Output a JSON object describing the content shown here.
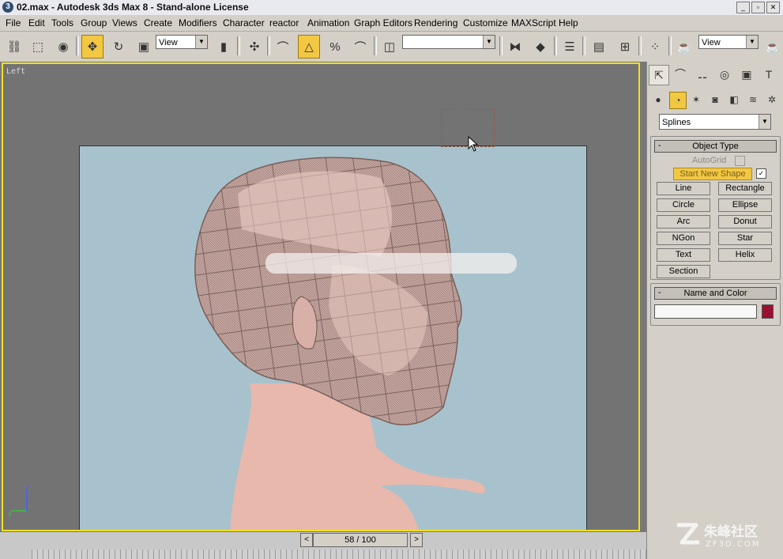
{
  "window": {
    "title": "02.max - Autodesk 3ds Max 8 - Stand-alone License",
    "app_icon": "3",
    "controls": [
      "_",
      "▫",
      "✕"
    ]
  },
  "menu": [
    "File",
    "Edit",
    "Tools",
    "Group",
    "Views",
    "Create",
    "Modifiers",
    "Character",
    "reactor",
    "Animation",
    "Graph Editors",
    "Rendering",
    "Customize",
    "MAXScript",
    "Help"
  ],
  "toolbar": {
    "ref_coord": "View",
    "named_selection": "",
    "view_dropdown": "View"
  },
  "viewport": {
    "label": "Left",
    "active_border_color": "#f0e020",
    "bg_color": "#a7c2cc",
    "axis_z": "z",
    "axis_y": "y"
  },
  "command_panel": {
    "category_dropdown": "Splines",
    "object_type": {
      "title": "Object Type",
      "autogrid_label": "AutoGrid",
      "start_new_shape_label": "Start New Shape",
      "start_new_shape_checked": true,
      "buttons": [
        "Line",
        "Rectangle",
        "Circle",
        "Ellipse",
        "Arc",
        "Donut",
        "NGon",
        "Star",
        "Text",
        "Helix",
        "Section"
      ]
    },
    "name_color": {
      "title": "Name and Color",
      "name_value": "",
      "swatch_color": "#9a1030"
    }
  },
  "timeline": {
    "frame_display": "58 / 100",
    "prev": "<",
    "next": ">",
    "current": 58,
    "total": 100
  },
  "watermark": {
    "brand": "朱峰社区",
    "domain": "ZF3D.COM"
  }
}
